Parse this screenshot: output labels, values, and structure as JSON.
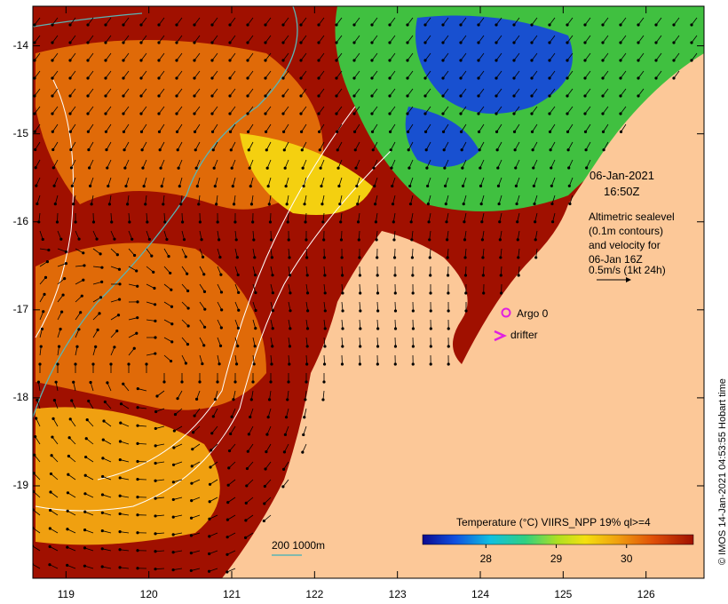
{
  "timestamp": {
    "date": "06-Jan-2021",
    "time": "16:50Z"
  },
  "altimetry_note": {
    "line1": "Altimetric sealevel",
    "line2": "(0.1m contours)",
    "line3": "and velocity for",
    "line4": "06-Jan 16Z",
    "scale": "0.5m/s (1kt 24h)"
  },
  "legend": {
    "argo": "Argo 0",
    "drifter": "drifter",
    "argo_color": "#e020e0",
    "drifter_color": "#e020e0"
  },
  "bathymetry_legend": {
    "depths": "200  1000m",
    "line_color": "#5ab4b4"
  },
  "colorbar": {
    "title": "Temperature (°C) VIIRS_NPP 19% ql>=4",
    "ticks": [
      "28",
      "29",
      "30"
    ],
    "tick_values": [
      28,
      29,
      30
    ],
    "range": [
      27.1,
      30.95
    ]
  },
  "credit": "© IMOS 14-Jan-2021 04:53:55 Hobart time",
  "axes": {
    "lat_labels": [
      "-14",
      "-15",
      "-16",
      "-17",
      "-18",
      "-19"
    ],
    "lat_values": [
      -14,
      -15,
      -16,
      -17,
      -18,
      -19
    ],
    "lon_labels": [
      "119",
      "120",
      "121",
      "122",
      "123",
      "124",
      "125",
      "126"
    ],
    "lon_values": [
      119,
      120,
      121,
      122,
      123,
      124,
      125,
      126
    ],
    "lon_range": [
      118.6,
      126.7
    ],
    "lat_range": [
      -20.05,
      -13.55
    ]
  },
  "colors": {
    "land": "#fcc898",
    "sea_hot": "#a01000",
    "sea_warm": "#e06a08",
    "sea_mid": "#f0a010",
    "sea_yellow": "#f4d010",
    "sea_cool_green": "#40c040",
    "sea_cool_blue": "#1850d0"
  }
}
